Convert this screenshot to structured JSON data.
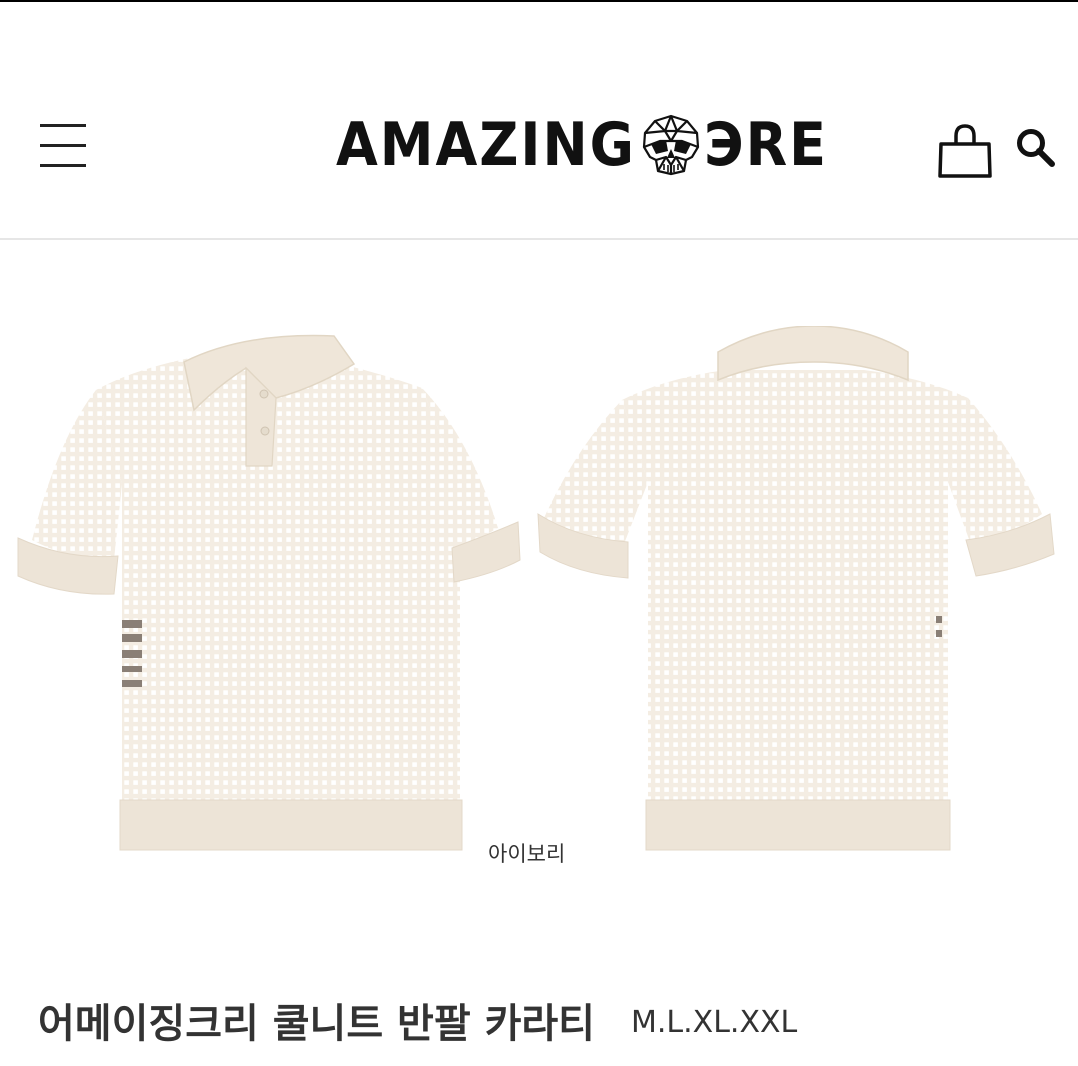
{
  "header": {
    "logo_left": "AMAZING",
    "logo_right": "ЭRE",
    "menu_icon": "hamburger-menu-icon",
    "cart_icon": "shopping-bag-icon",
    "search_icon": "search-icon"
  },
  "product": {
    "color_label": "아이보리",
    "name": "어메이징크리 쿨니트 반팔 카라티",
    "sizes": "M.L.XL.XXL",
    "shirt_color": "#f4ede3",
    "trim_color": "#ede4d7"
  }
}
